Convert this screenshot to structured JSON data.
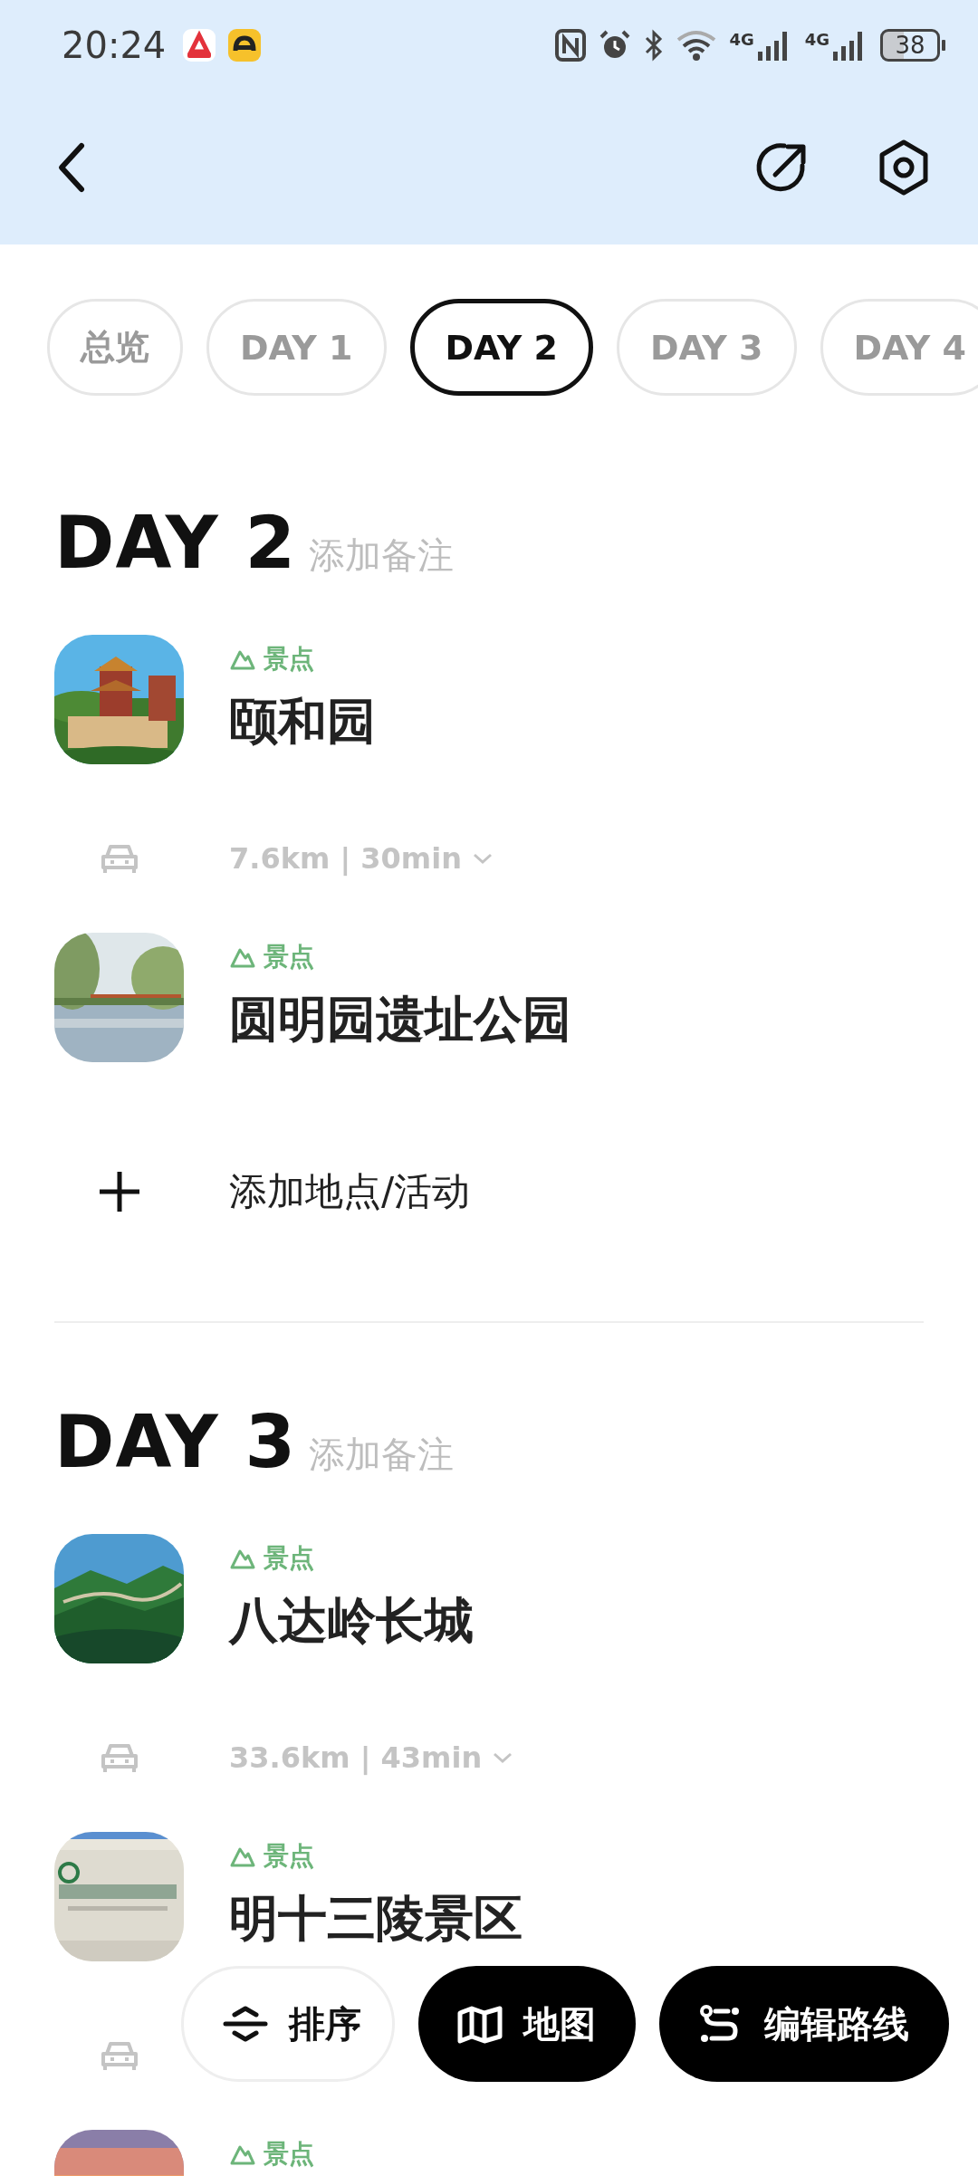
{
  "status_bar": {
    "time": "20:24",
    "signals": [
      "4G",
      "4G"
    ],
    "battery": "38"
  },
  "tabs": [
    {
      "label": "总览",
      "selected": false
    },
    {
      "label": "DAY 1",
      "selected": false
    },
    {
      "label": "DAY 2",
      "selected": true
    },
    {
      "label": "DAY 3",
      "selected": false
    },
    {
      "label": "DAY 4",
      "selected": false
    }
  ],
  "days": [
    {
      "title": "DAY 2",
      "note_hint": "添加备注",
      "entries": [
        {
          "kind": "place",
          "tag": "景点",
          "title": "颐和园"
        },
        {
          "kind": "transit",
          "text": "7.6km | 30min",
          "expandable": true
        },
        {
          "kind": "place",
          "tag": "景点",
          "title": "圆明园遗址公园"
        },
        {
          "kind": "add",
          "label": "添加地点/活动"
        }
      ]
    },
    {
      "title": "DAY 3",
      "note_hint": "添加备注",
      "entries": [
        {
          "kind": "place",
          "tag": "景点",
          "title": "八达岭长城"
        },
        {
          "kind": "transit",
          "text": "33.6km | 43min",
          "expandable": true
        },
        {
          "kind": "place",
          "tag": "景点",
          "title": "明十三陵景区"
        },
        {
          "kind": "transit"
        },
        {
          "kind": "place",
          "tag": "景点"
        }
      ]
    }
  ],
  "actions": [
    {
      "kind": "sort",
      "label": "排序"
    },
    {
      "kind": "map",
      "label": "地图"
    },
    {
      "kind": "route",
      "label": "编辑路线"
    }
  ]
}
